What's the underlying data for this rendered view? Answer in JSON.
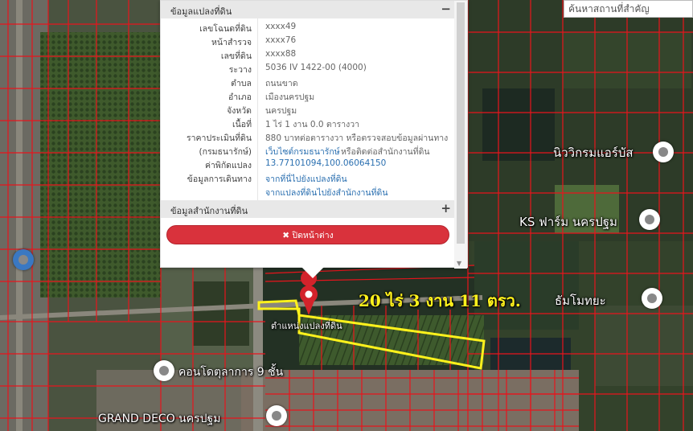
{
  "search": {
    "placeholder": "ค้นหาสถานที่สำคัญ"
  },
  "popup": {
    "section1_title": "ข้อมูลแปลงที่ดิน",
    "section1_toggle": "−",
    "rows": [
      {
        "label": "เลขโฉนดที่ดิน",
        "value": "xxxx49"
      },
      {
        "label": "หน้าสำรวจ",
        "value": "xxxx76"
      },
      {
        "label": "เลขที่ดิน",
        "value": "xxxx88"
      },
      {
        "label": "ระวาง",
        "value": "5036 IV 1422-00 (4000)"
      },
      {
        "label": "ตำบล",
        "value": "ถนนขาด"
      },
      {
        "label": "อำเภอ",
        "value": "เมืองนครปฐม"
      },
      {
        "label": "จังหวัด",
        "value": "นครปฐม"
      },
      {
        "label": "เนื้อที่",
        "value": "1 ไร่ 1 งาน 0.0 ตารางวา"
      },
      {
        "label": "ราคาประเมินที่ดิน",
        "value": "880 บาทต่อตารางวา หรือตรวจสอบข้อมูลผ่านทาง"
      },
      {
        "label": "(กรมธนารักษ์)",
        "link": "เว็บไซต์กรมธนารักษ์",
        "value": "หรือติดต่อสำนักงานที่ดิน"
      },
      {
        "label": "ค่าพิกัดแปลง",
        "link": "13.77101094,100.06064150"
      },
      {
        "label": "ข้อมูลการเดินทาง",
        "link": "จากที่นี่ไปยังแปลงที่ดิน"
      },
      {
        "label": "",
        "link": "จากแปลงที่ดินไปยังสำนักงานที่ดิน"
      }
    ],
    "section2_title": "ข้อมูลสำนักงานที่ดิน",
    "section2_toggle": "+",
    "close_label": "✖ ปิดหน้าต่าง"
  },
  "map": {
    "area_label": "20 ไร่   3 งาน 11 ตรว.",
    "marker_caption": "ตำแหน่งแปลงที่ดิน",
    "places": [
      {
        "name": "คอนโดตุลาการ 9 ชั้น"
      },
      {
        "name": "GRAND DECO นครปฐม"
      },
      {
        "name": "นิววิกรมแอร์บัส"
      },
      {
        "name": "KS ฟาร์ม นครปฐม"
      },
      {
        "name": "ธัมโมทยะ"
      }
    ],
    "colors": {
      "parcel_lines": "#e8141c",
      "highlight": "#fff21c",
      "marker": "#d3232b"
    }
  }
}
